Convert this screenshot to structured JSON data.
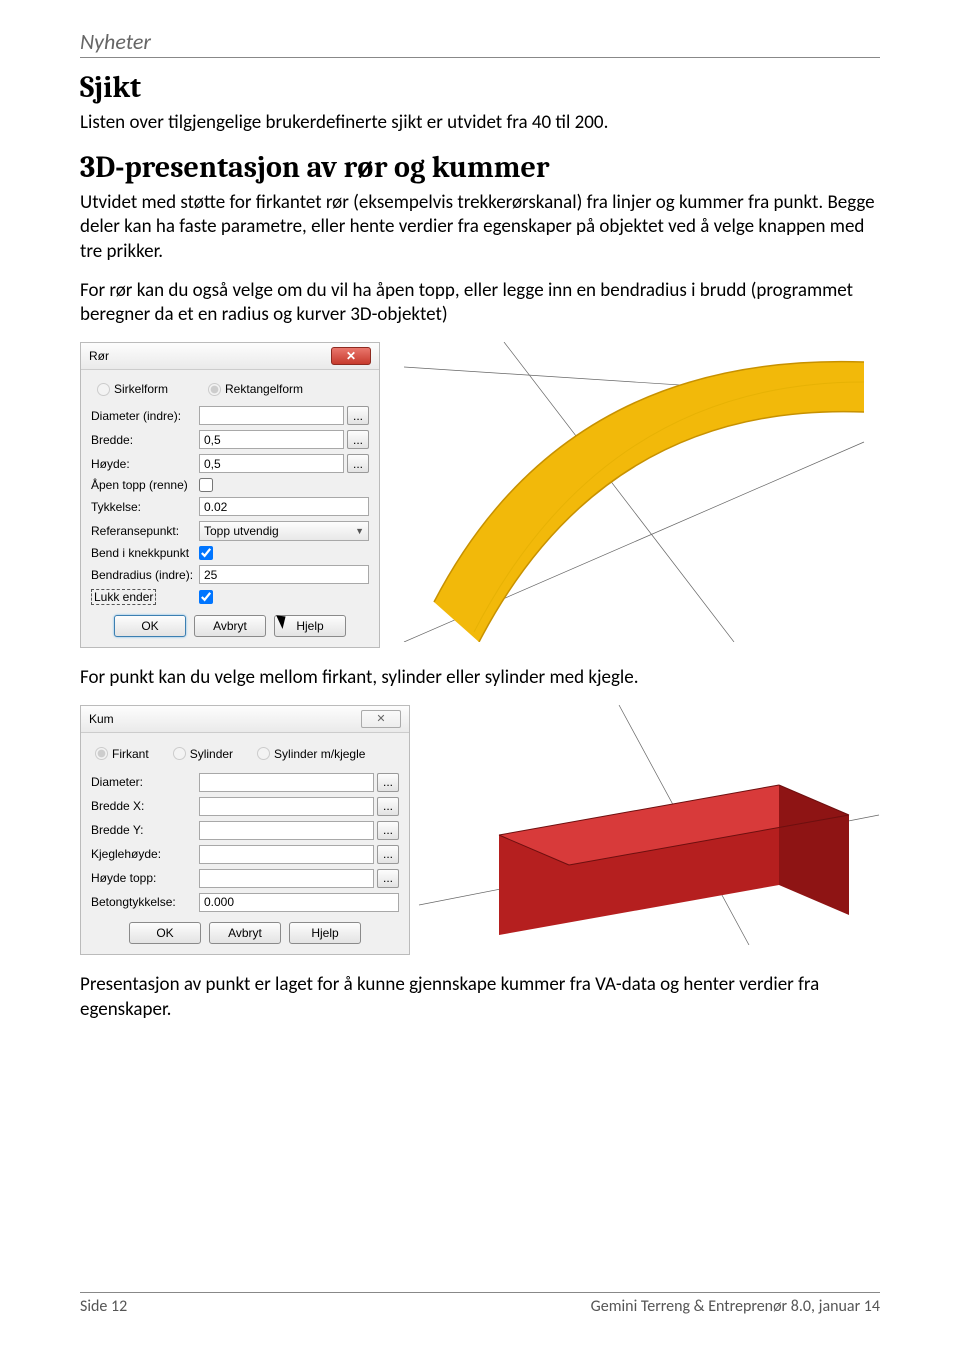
{
  "header": "Nyheter",
  "section1": {
    "title": "Sjikt",
    "text": "Listen over tilgjengelige brukerdefinerte sjikt er utvidet fra 40 til 200."
  },
  "section2": {
    "title": "3D-presentasjon av rør og kummer",
    "para1": "Utvidet med støtte for firkantet rør (eksempelvis trekkerørskanal) fra linjer og kummer fra punkt. Begge deler kan ha faste parametre, eller hente verdier fra egenskaper på objektet ved å velge knappen med tre prikker.",
    "para2": "For rør kan du også velge om du vil ha åpen topp, eller legge inn en bendradius i brudd (programmet beregner da et en radius og kurver 3D-objektet)",
    "para3": "For punkt kan du velge mellom firkant, sylinder eller sylinder med kjegle.",
    "para4": "Presentasjon av punkt er laget for å kunne gjennskape kummer fra VA-data og henter verdier fra egenskaper."
  },
  "ror_dialog": {
    "title": "Rør",
    "radio1": "Sirkelform",
    "radio2": "Rektangelform",
    "diameter": "Diameter (indre):",
    "bredde": "Bredde:",
    "bredde_val": "0,5",
    "hoyde": "Høyde:",
    "hoyde_val": "0,5",
    "apen": "Åpen topp (renne)",
    "tykkelse": "Tykkelse:",
    "tykkelse_val": "0.02",
    "ref": "Referansepunkt:",
    "ref_val": "Topp utvendig",
    "bend": "Bend i knekkpunkt",
    "bendradius": "Bendradius (indre):",
    "bendradius_val": "25",
    "lukk": "Lukk ender",
    "ok": "OK",
    "avbryt": "Avbryt",
    "hjelp": "Hjelp",
    "dots": "..."
  },
  "kum_dialog": {
    "title": "Kum",
    "radio1": "Firkant",
    "radio2": "Sylinder",
    "radio3": "Sylinder m/kjegle",
    "diameter": "Diameter:",
    "breddex": "Bredde X:",
    "breddey": "Bredde Y:",
    "kjegle": "Kjeglehøyde:",
    "hoydetopp": "Høyde topp:",
    "betong": "Betongtykkelse:",
    "betong_val": "0.000",
    "ok": "OK",
    "avbryt": "Avbryt",
    "hjelp": "Hjelp",
    "dots": "..."
  },
  "footer": {
    "left": "Side 12",
    "right": "Gemini Terreng & Entreprenør 8.0, januar 14"
  }
}
